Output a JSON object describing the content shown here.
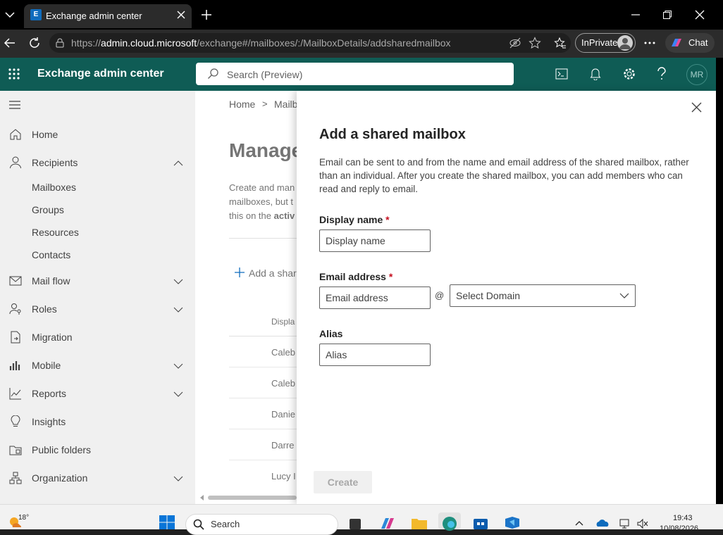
{
  "browser": {
    "tab_title": "Exchange admin center",
    "url_prefix": "https://",
    "url_domain": "admin.cloud.microsoft",
    "url_path": "/exchange#/mailboxes/:/MailboxDetails/addsharedmailbox",
    "inprivate_label": "InPrivate",
    "chat_label": "Chat"
  },
  "app": {
    "title": "Exchange admin center",
    "search_placeholder": "Search (Preview)",
    "avatar_initials": "MR"
  },
  "sidebar": {
    "items": [
      {
        "label": "Home"
      },
      {
        "label": "Recipients"
      },
      {
        "label": "Mailboxes"
      },
      {
        "label": "Groups"
      },
      {
        "label": "Resources"
      },
      {
        "label": "Contacts"
      },
      {
        "label": "Mail flow"
      },
      {
        "label": "Roles"
      },
      {
        "label": "Migration"
      },
      {
        "label": "Mobile"
      },
      {
        "label": "Reports"
      },
      {
        "label": "Insights"
      },
      {
        "label": "Public folders"
      },
      {
        "label": "Organization"
      }
    ]
  },
  "background": {
    "breadcrumb_home": "Home",
    "breadcrumb_sep": ">",
    "breadcrumb_current": "Mailb",
    "page_title": "Manage",
    "desc_line1": "Create and man",
    "desc_line2": "mailboxes, but t",
    "desc_line3_prefix": "this on the ",
    "desc_line3_bold": "activ",
    "add_button": "Add a shar",
    "col_header": "Displa",
    "rows": [
      "Caleb",
      "Caleb",
      "Danie",
      "Darre",
      "Lucy I"
    ]
  },
  "panel": {
    "title": "Add a shared mailbox",
    "description": "Email can be sent to and from the name and email address of the shared mailbox, rather than an individual. After you create the shared mailbox, you can add members who can read and reply to email.",
    "display_name_label": "Display name",
    "display_name_placeholder": "Display name",
    "email_label": "Email address",
    "email_placeholder": "Email address",
    "at_sign": "@",
    "domain_select": "Select Domain",
    "alias_label": "Alias",
    "alias_placeholder": "Alias",
    "required_mark": "*",
    "create_label": "Create"
  },
  "taskbar": {
    "weather": "18°",
    "search_label": "Search",
    "time": "19:43",
    "date": "10/08/2026"
  },
  "colors": {
    "app_header": "#0f5c55",
    "sidebar_bg": "#f0f0f0",
    "required": "#c50f1f"
  }
}
